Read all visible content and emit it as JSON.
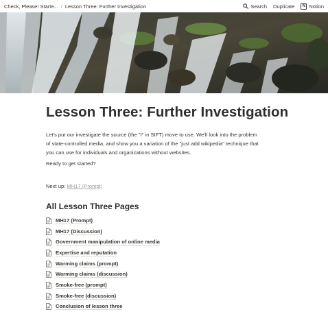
{
  "topbar": {
    "breadcrumbs": [
      "Check, Please! Starte...",
      "Lesson Three: Further Investigation"
    ],
    "separator": "/",
    "search_label": "Search",
    "duplicate_label": "Duplicate",
    "notion_label": "Notion",
    "icons": [
      "search-icon",
      "notion-logo-icon"
    ]
  },
  "cover": {
    "icon": "waterfall-cover-image"
  },
  "page": {
    "title": "Lesson Three: Further Investigation",
    "intro_line1": "Let's put our investigate the source (the \"I\" in SIFT) move to use. We'll look into the problem",
    "intro_line2": "of state-controlled media, and show you a variation of the \"just add wikipedia\" technique that",
    "intro_line3": "you can use for individuals and organizations without websites.",
    "ready": "Ready to get started?",
    "next_up_label": "Next up: ",
    "next_up_link": "MH17 (Prompt)"
  },
  "pages_section": {
    "heading": "All Lesson Three Pages",
    "item_icon": "document-icon",
    "items": [
      {
        "label": "MH17 (Prompt)"
      },
      {
        "label": "MH17 (Discussion)"
      },
      {
        "label": "Government manipulation of online media"
      },
      {
        "label": "Expertise and reputation"
      },
      {
        "label": "Warming claims (prompt)"
      },
      {
        "label": "Warming claims (discussion)"
      },
      {
        "label": "Smoke-free (prompt)"
      },
      {
        "label": "Smoke-free (discussion)"
      },
      {
        "label": "Conclusion of lesson three"
      }
    ]
  }
}
